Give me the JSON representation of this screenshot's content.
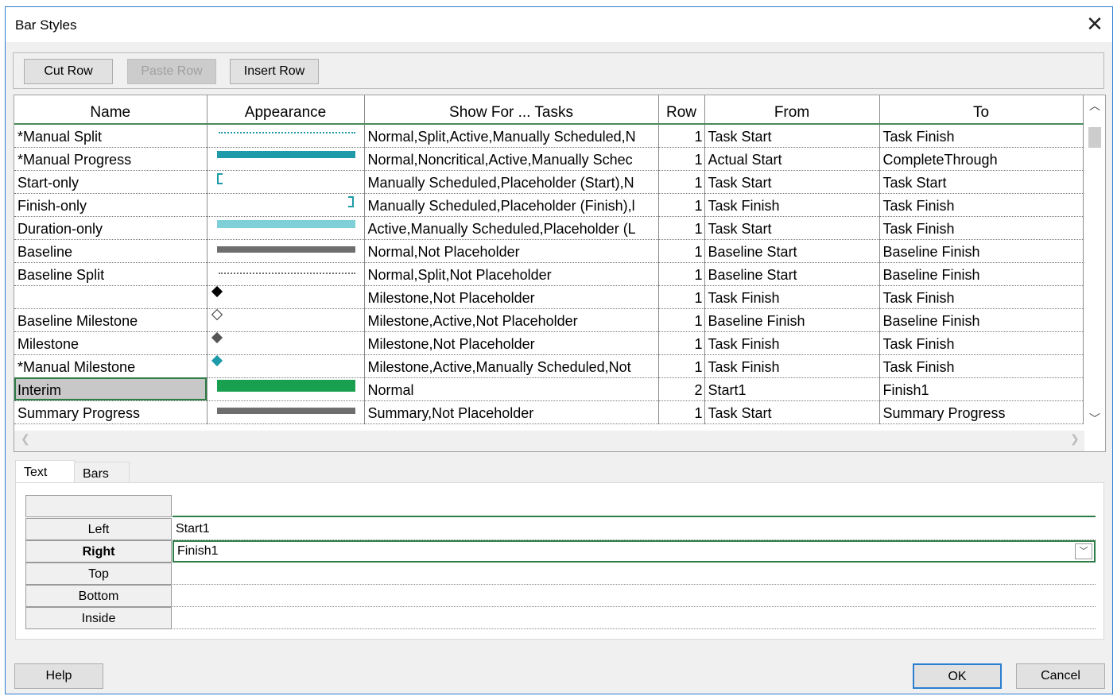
{
  "window": {
    "title": "Bar Styles",
    "close_glyph": "✕"
  },
  "toolbar": {
    "cut_row": "Cut Row",
    "paste_row": "Paste Row",
    "insert_row": "Insert Row"
  },
  "columns": [
    "Name",
    "Appearance",
    "Show For ... Tasks",
    "Row",
    "From",
    "To"
  ],
  "rows": [
    {
      "name": "*Manual Split",
      "appearance": "dotted-teal-line",
      "show_for": "Normal,Split,Active,Manually Scheduled,N",
      "row": "1",
      "from": "Task Start",
      "to": "Task Finish"
    },
    {
      "name": "*Manual Progress",
      "appearance": "teal-bar",
      "show_for": "Normal,Noncritical,Active,Manually Schec",
      "row": "1",
      "from": "Actual Start",
      "to": "CompleteThrough"
    },
    {
      "name": "Start-only",
      "appearance": "start-bracket",
      "show_for": "Manually Scheduled,Placeholder (Start),N",
      "row": "1",
      "from": "Task Start",
      "to": "Task Start"
    },
    {
      "name": "Finish-only",
      "appearance": "finish-bracket",
      "show_for": "Manually Scheduled,Placeholder (Finish),l",
      "row": "1",
      "from": "Task Finish",
      "to": "Task Finish"
    },
    {
      "name": "Duration-only",
      "appearance": "light-teal-bar",
      "show_for": "Active,Manually Scheduled,Placeholder (L",
      "row": "1",
      "from": "Task Start",
      "to": "Task Finish"
    },
    {
      "name": "Baseline",
      "appearance": "gray-bar",
      "show_for": "Normal,Not Placeholder",
      "row": "1",
      "from": "Baseline Start",
      "to": "Baseline Finish"
    },
    {
      "name": "Baseline Split",
      "appearance": "dotted-gray-line",
      "show_for": "Normal,Split,Not Placeholder",
      "row": "1",
      "from": "Baseline Start",
      "to": "Baseline Finish"
    },
    {
      "name": "",
      "appearance": "black-diamond",
      "show_for": "Milestone,Not Placeholder",
      "row": "1",
      "from": "Task Finish",
      "to": "Task Finish"
    },
    {
      "name": "Baseline Milestone",
      "appearance": "hollow-diamond",
      "show_for": "Milestone,Active,Not Placeholder",
      "row": "1",
      "from": "Baseline Finish",
      "to": "Baseline Finish"
    },
    {
      "name": "Milestone",
      "appearance": "gray-diamond",
      "show_for": "Milestone,Not Placeholder",
      "row": "1",
      "from": "Task Finish",
      "to": "Task Finish"
    },
    {
      "name": "*Manual Milestone",
      "appearance": "teal-diamond",
      "show_for": "Milestone,Active,Manually Scheduled,Not",
      "row": "1",
      "from": "Task Finish",
      "to": "Task Finish"
    },
    {
      "name": "Interim",
      "appearance": "green-bar",
      "show_for": "Normal",
      "row": "2",
      "from": "Start1",
      "to": "Finish1",
      "selected": true
    },
    {
      "name": "Summary Progress",
      "appearance": "gray-bar",
      "show_for": "Summary,Not Placeholder",
      "row": "1",
      "from": "Task Start",
      "to": "Summary Progress"
    }
  ],
  "tabs": {
    "text": "Text",
    "bars": "Bars"
  },
  "text_props": [
    {
      "label": "Left",
      "value": "Start1"
    },
    {
      "label": "Right",
      "value": "Finish1"
    },
    {
      "label": "Top",
      "value": ""
    },
    {
      "label": "Bottom",
      "value": ""
    },
    {
      "label": "Inside",
      "value": ""
    }
  ],
  "footer": {
    "help": "Help",
    "ok": "OK",
    "cancel": "Cancel"
  },
  "colors": {
    "teal": "#1f9aa8",
    "light_teal": "#7fcfd6",
    "gray": "#6e6e6e",
    "green": "#18a050",
    "accent_border": "#2d7d46"
  }
}
